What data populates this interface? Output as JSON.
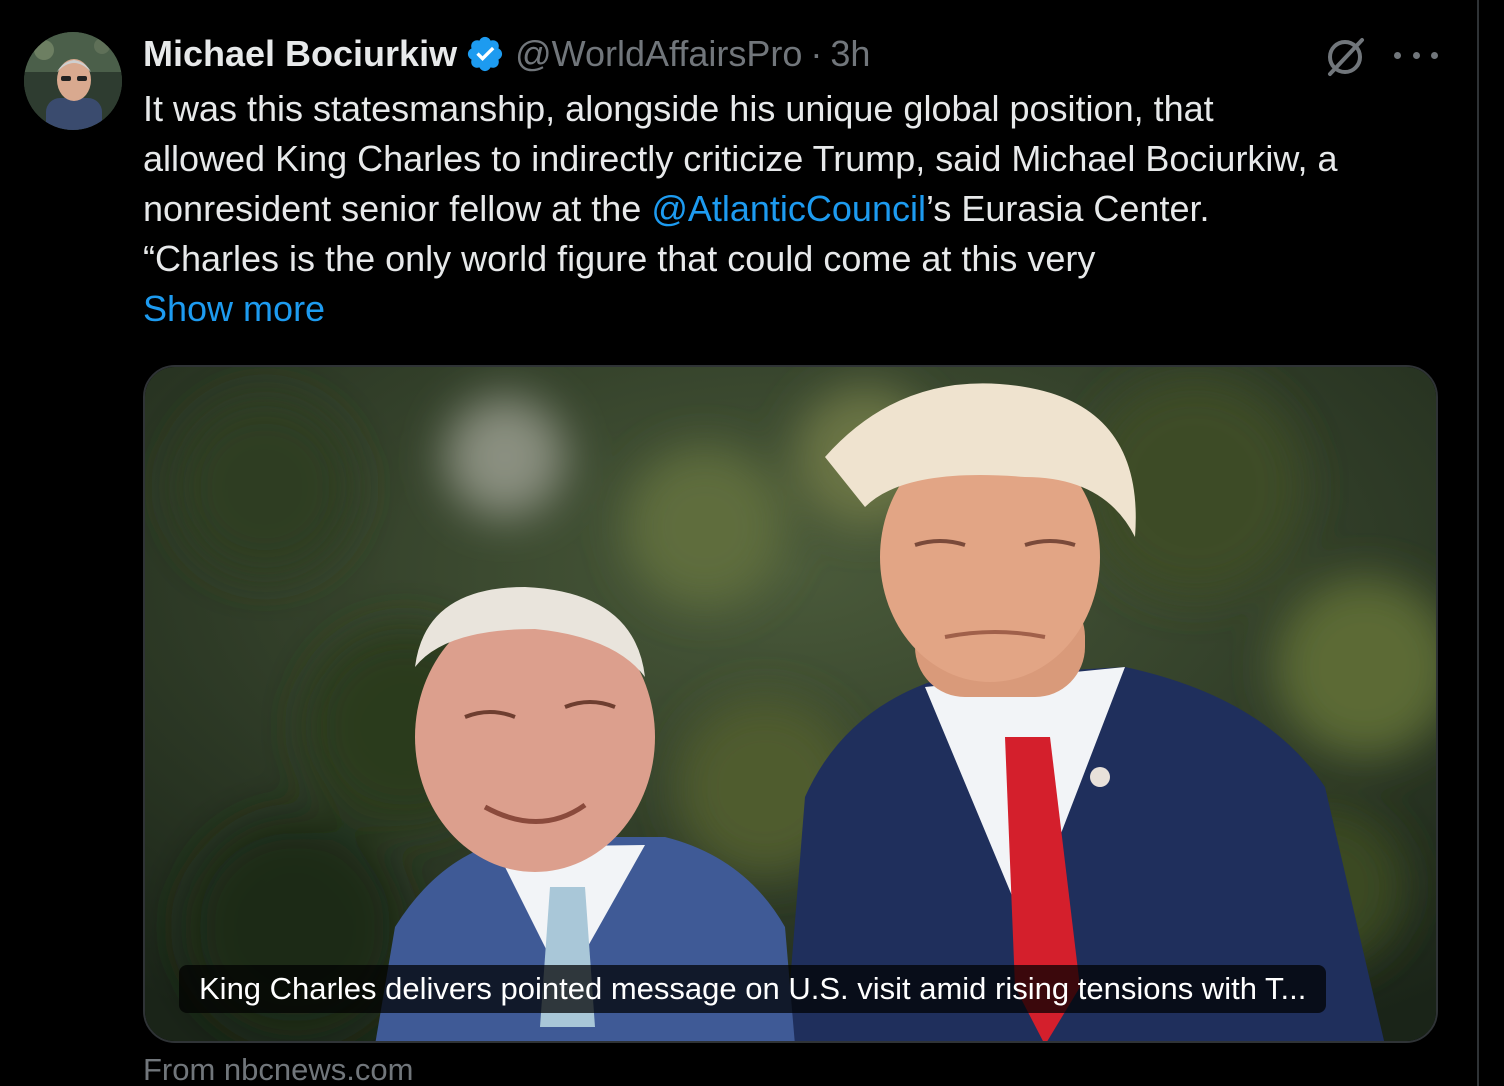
{
  "tweet": {
    "author_name": "Michael Bociurkiw",
    "handle": "@WorldAffairsPro",
    "separator": "·",
    "time": "3h",
    "text_lines": [
      "It was this statesmanship, alongside his unique global position, that",
      "allowed King Charles to indirectly criticize Trump, said Michael Bociurkiw, a",
      "nonresident senior fellow at the ",
      "“Charles is the only world figure that could come at this very"
    ],
    "mention": "@AtlanticCouncil",
    "line3_suffix": "’s Eurasia Center.",
    "show_more": "Show more"
  },
  "card": {
    "caption": "King Charles delivers pointed message on U.S. visit amid rising tensions with T...",
    "source": "From nbcnews.com"
  },
  "colors": {
    "background": "#000000",
    "text": "#e7e9ea",
    "muted": "#71767b",
    "link": "#1d9bf0",
    "border": "#2f3336"
  },
  "icons": {
    "verified": "verified-badge-icon",
    "grok": "grok-icon",
    "more": "more-icon"
  }
}
